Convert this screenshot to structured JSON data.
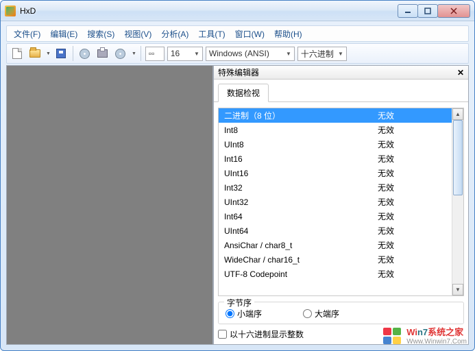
{
  "title": "HxD",
  "menu": {
    "file": "文件(F)",
    "edit": "编辑(E)",
    "search": "搜索(S)",
    "view": "视图(V)",
    "analyze": "分析(A)",
    "tools": "工具(T)",
    "window": "窗口(W)",
    "help": "帮助(H)"
  },
  "toolbar": {
    "bytes_per_row": "16",
    "encoding": "Windows (ANSI)",
    "base": "十六进制"
  },
  "panel": {
    "title": "特殊编辑器",
    "tab_inspect": "数据检视",
    "rows": [
      {
        "label": "二进制（8 位）",
        "value": "无效"
      },
      {
        "label": "Int8",
        "value": "无效"
      },
      {
        "label": "UInt8",
        "value": "无效"
      },
      {
        "label": "Int16",
        "value": "无效"
      },
      {
        "label": "UInt16",
        "value": "无效"
      },
      {
        "label": "Int32",
        "value": "无效"
      },
      {
        "label": "UInt32",
        "value": "无效"
      },
      {
        "label": "Int64",
        "value": "无效"
      },
      {
        "label": "UInt64",
        "value": "无效"
      },
      {
        "label": "AnsiChar / char8_t",
        "value": "无效"
      },
      {
        "label": "WideChar / char16_t",
        "value": "无效"
      },
      {
        "label": "UTF-8 Codepoint",
        "value": "无效"
      }
    ],
    "byte_order_label": "字节序",
    "little_endian": "小端序",
    "big_endian": "大端序",
    "hex_checkbox": "以十六进制显示整数"
  },
  "watermark": {
    "line1a": "Wi",
    "line1b": "n7",
    "line1c": "系统之家",
    "line2": "Www.Winwin7.Com"
  }
}
